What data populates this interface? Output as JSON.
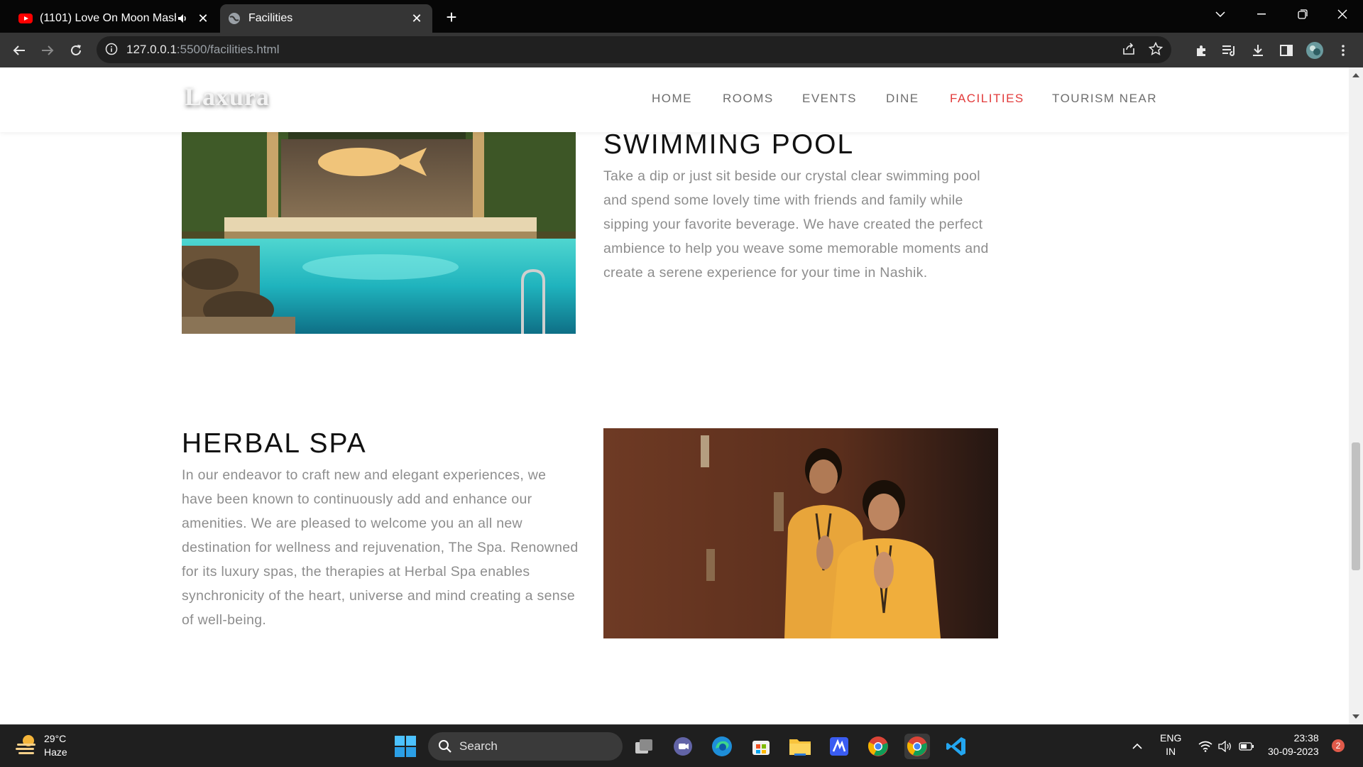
{
  "browser": {
    "tabs": [
      {
        "title": "(1101) Love On Moon Mash",
        "favicon": "youtube-icon",
        "audio": true
      },
      {
        "title": "Facilities",
        "favicon": "globe-icon",
        "active": true
      }
    ],
    "new_tab_symbol": "+",
    "url_host": "127.0.0.1",
    "url_path": ":5500/facilities.html"
  },
  "site": {
    "logo": "Laxura",
    "nav": [
      "HOME",
      "ROOMS",
      "EVENTS",
      "DINE",
      "FACILITIES",
      "TOURISM NEAR"
    ],
    "active_nav": "FACILITIES",
    "accent": "#e23a3a"
  },
  "sections": [
    {
      "title": "SWIMMING POOL",
      "text": "Take a dip or just sit beside our crystal clear swimming pool and spend some lovely time with friends and family while sipping your favorite beverage. We have created the perfect ambience to help you weave some memorable moments and create a serene experience for your time in Nashik."
    },
    {
      "title": "HERBAL SPA",
      "text": "In our endeavor to craft new and elegant experiences, we have been known to continuously add and enhance our amenities. We are pleased to welcome you an all new destination for wellness and rejuvenation, The Spa. Renowned for its luxury spas, the therapies at Herbal Spa enables synchronicity of the heart, universe and mind creating a sense of well-being."
    }
  ],
  "taskbar": {
    "weather_temp": "29°C",
    "weather_desc": "Haze",
    "search_label": "Search",
    "lang_top": "ENG",
    "lang_bottom": "IN",
    "time": "23:38",
    "date": "30-09-2023",
    "notification_count": "2"
  }
}
